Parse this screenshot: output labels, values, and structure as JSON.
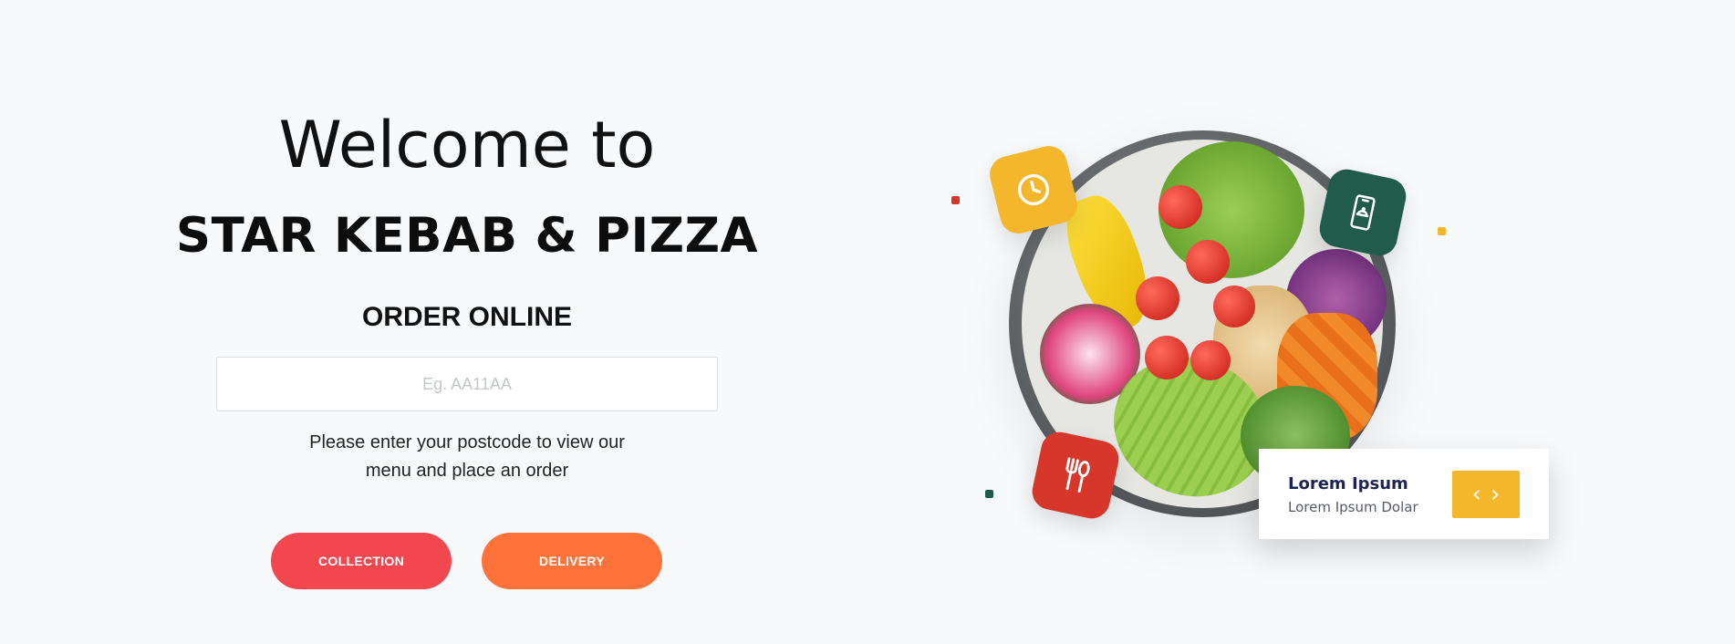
{
  "hero": {
    "welcome": "Welcome to",
    "brand": "STAR KEBAB & PIZZA",
    "order_heading": "ORDER ONLINE",
    "postcode_placeholder": "Eg. AA11AA",
    "helper_line1": "Please enter your postcode to view our",
    "helper_line2": "menu and place an order",
    "collection_label": "COLLECTION",
    "delivery_label": "DELIVERY"
  },
  "card": {
    "title": "Lorem Ipsum",
    "subtitle": "Lorem Ipsum Dolar",
    "prev_glyph": "‹",
    "next_glyph": "›"
  },
  "icons": [
    "clock-icon",
    "mobile-order-icon",
    "fork-spoon-icon"
  ],
  "colors": {
    "collection": "#f2474f",
    "delivery": "#ff733a",
    "yellow": "#f4b72c",
    "green": "#215b4b",
    "red": "#d6372a",
    "card_title": "#1d2352"
  }
}
